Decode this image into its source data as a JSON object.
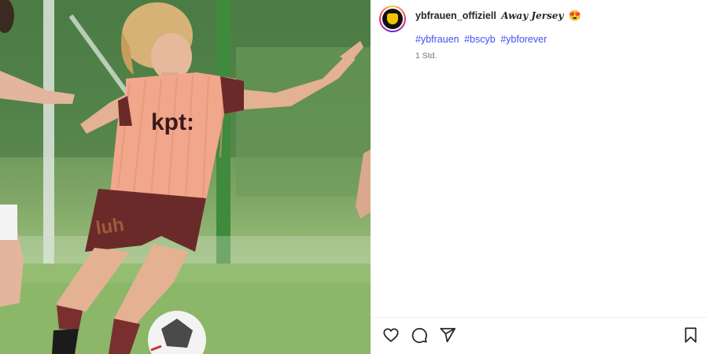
{
  "post": {
    "username": "ybfrauen_offiziell",
    "caption": "Away Jersey",
    "caption_emoji": "😍",
    "hashtags": [
      "#ybfrauen",
      "#bscyb",
      "#ybforever"
    ],
    "timestamp": "1 Std."
  },
  "photo": {
    "shirt_sponsor": "kpt:",
    "shorts_text": "luh"
  },
  "actions": {
    "like_icon": "heart-icon",
    "comment_icon": "comment-icon",
    "share_icon": "share-icon",
    "save_icon": "bookmark-icon"
  },
  "colors": {
    "hashtag": "#4150f7",
    "jersey": "#f0a58a",
    "shorts": "#6b2a2a",
    "pitch": "#8fb86f"
  }
}
